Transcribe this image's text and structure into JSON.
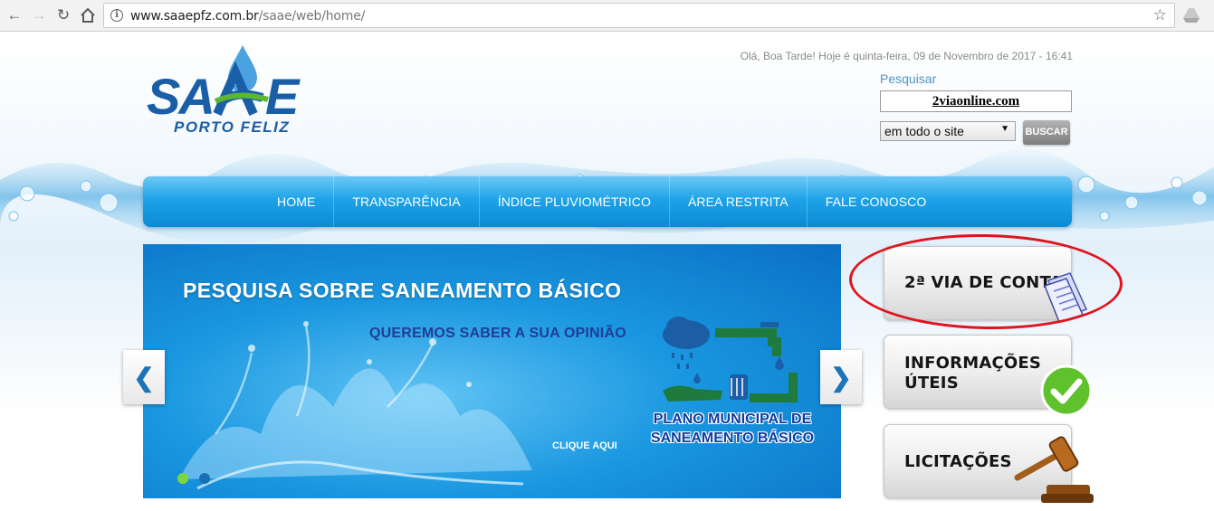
{
  "browser": {
    "url_host": "www.saaepfz.com.br",
    "url_path": "/saae/web/home/"
  },
  "header": {
    "logo_text": "SAAE",
    "logo_subtitle": "PORTO FELIZ",
    "greeting": "Olá, Boa Tarde! Hoje é quinta-feira, 09 de Novembro de 2017 - 16:41"
  },
  "search": {
    "label": "Pesquisar",
    "value": "2viaonline.com",
    "scope_selected": "em todo o site",
    "button_label": "BUSCAR"
  },
  "menu": {
    "items": [
      {
        "label": "HOME"
      },
      {
        "label": "TRANSPARÊNCIA"
      },
      {
        "label": "ÍNDICE PLUVIOMÉTRICO"
      },
      {
        "label": "ÁREA RESTRITA"
      },
      {
        "label": "FALE CONOSCO"
      }
    ]
  },
  "slider": {
    "title": "PESQUISA SOBRE SANEAMENTO BÁSICO",
    "subtitle": "QUEREMOS SABER A SUA OPINIÃO",
    "plano_line1": "PLANO MUNICIPAL DE",
    "plano_line2": "SANEAMENTO BÁSICO",
    "cta": "CLIQUE AQUI",
    "current_slide": 1,
    "slide_count": 2
  },
  "side_buttons": {
    "conta": "2ª VIA DE CONTA",
    "info_line1": "INFORMAÇÕES",
    "info_line2": "ÚTEIS",
    "licitacoes": "LICITAÇÕES"
  },
  "colors": {
    "menu_blue": "#1ea3e8",
    "annotation_red": "#e0141d",
    "logo_blue": "#1a5ea8",
    "logo_green": "#5cb832"
  }
}
